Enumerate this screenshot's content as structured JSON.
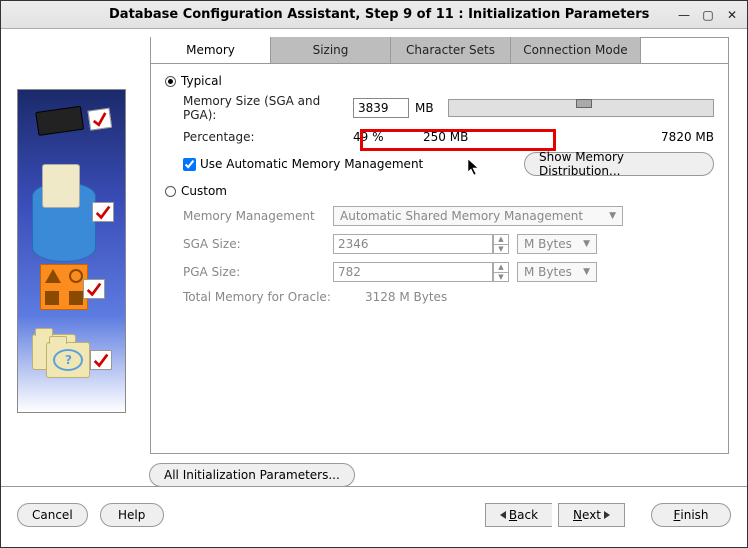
{
  "window": {
    "title": "Database Configuration Assistant, Step 9 of 11 : Initialization Parameters"
  },
  "tabs": {
    "memory": "Memory",
    "sizing": "Sizing",
    "charsets": "Character Sets",
    "connmode": "Connection Mode"
  },
  "memory_tab": {
    "typical_label": "Typical",
    "memsize_label": "Memory Size (SGA and PGA):",
    "memsize_value": "3839",
    "memsize_unit": "MB",
    "percentage_label": "Percentage:",
    "percentage_value": "49 %",
    "slider_min": "250 MB",
    "slider_max": "7820 MB",
    "use_amm_label": "Use Automatic Memory Management",
    "show_dist_label": "Show Memory Distribution...",
    "custom_label": "Custom",
    "memmgmt_label": "Memory Management",
    "memmgmt_value": "Automatic Shared Memory Management",
    "sga_label": "SGA Size:",
    "sga_value": "2346",
    "pga_label": "PGA Size:",
    "pga_value": "782",
    "unit_select": "M Bytes",
    "total_label": "Total Memory for Oracle:",
    "total_value": "3128 M Bytes",
    "all_params": "All Initialization Parameters..."
  },
  "footer": {
    "cancel": "Cancel",
    "help": "Help",
    "back": "Back",
    "next": "Next",
    "finish": "Finish"
  }
}
